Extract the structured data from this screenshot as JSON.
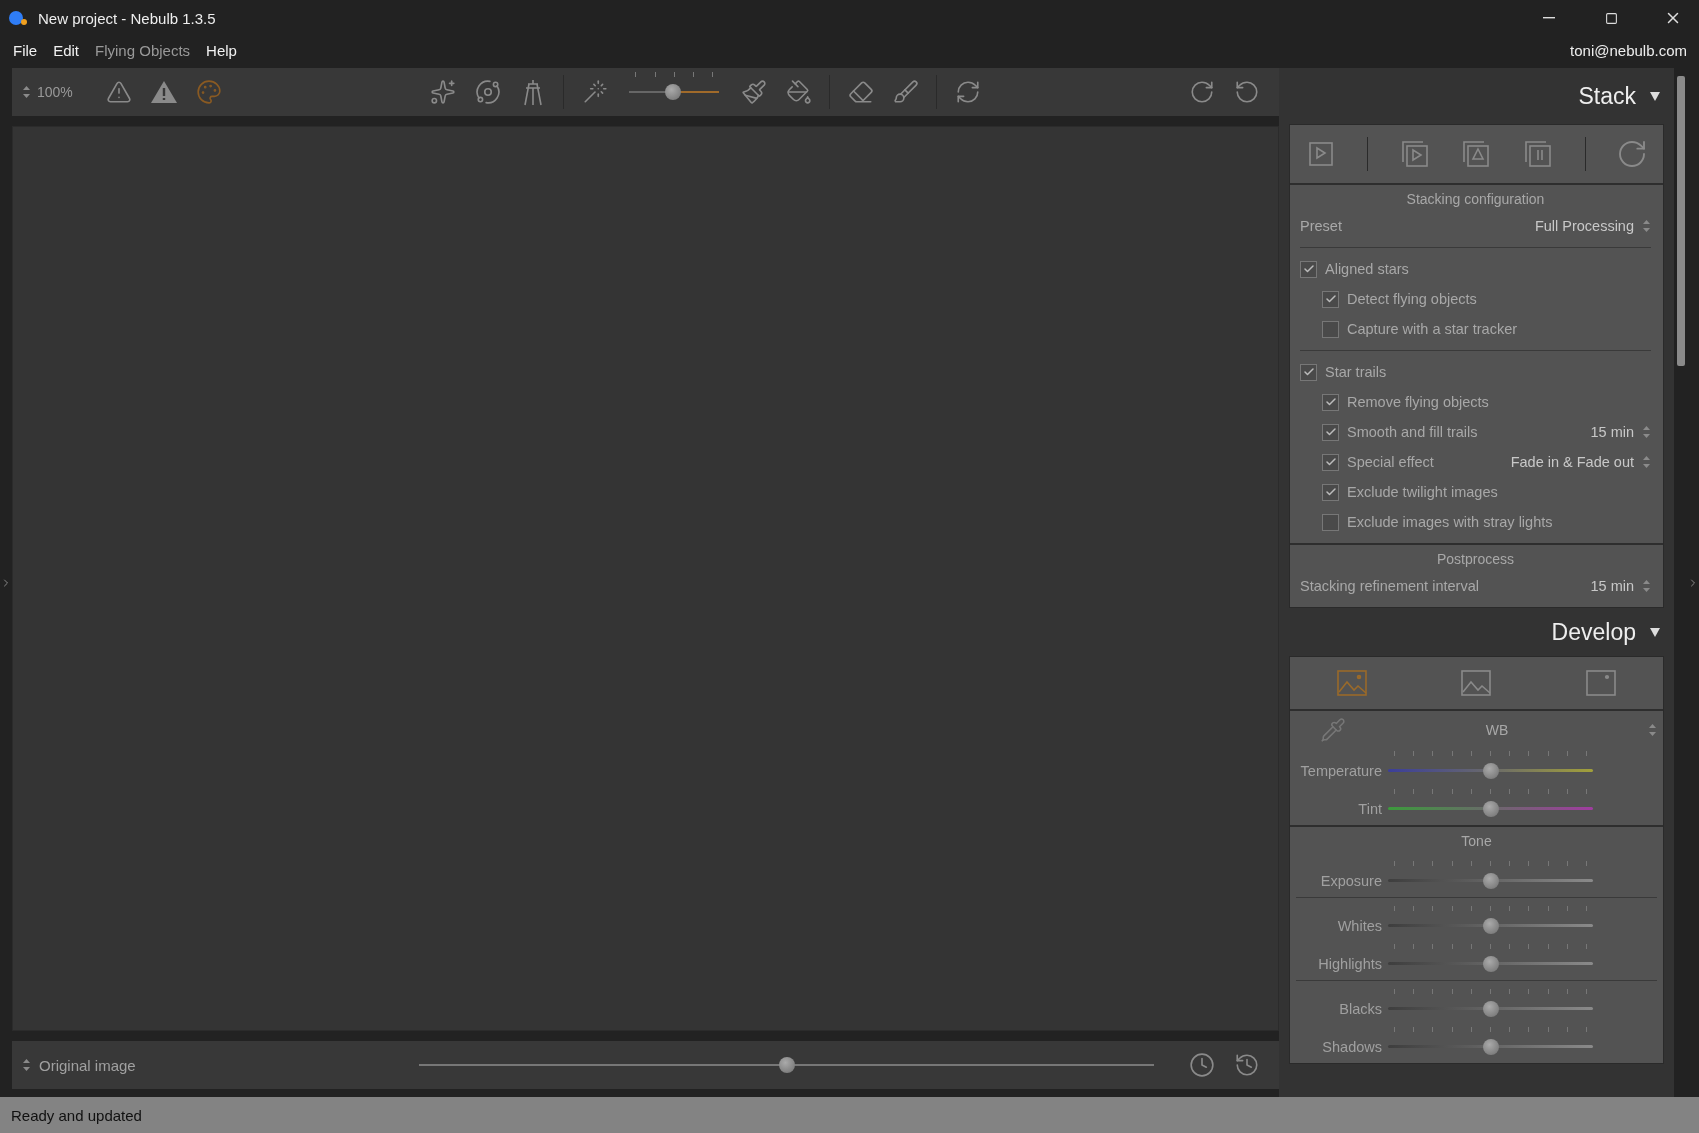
{
  "window": {
    "title": "New project - Nebulb 1.3.5"
  },
  "menu": [
    {
      "label": "File",
      "disabled": false
    },
    {
      "label": "Edit",
      "disabled": false
    },
    {
      "label": "Flying Objects",
      "disabled": true
    },
    {
      "label": "Help",
      "disabled": false
    }
  ],
  "account": "toni@nebulb.com",
  "toolbar": {
    "zoom": "100%",
    "brush_size": {
      "level": 0.48
    }
  },
  "viewer": {
    "compare_mode": "Original image",
    "position": {
      "level": 0.5
    }
  },
  "stack": {
    "title": "Stack",
    "config_title": "Stacking configuration",
    "preset": {
      "label": "Preset",
      "value": "Full Processing"
    },
    "groups": [
      {
        "label": "Aligned stars",
        "checked": true,
        "children": [
          {
            "label": "Detect flying objects",
            "checked": true
          },
          {
            "label": "Capture with a star tracker",
            "checked": false
          }
        ]
      },
      {
        "label": "Star trails",
        "checked": true,
        "children": [
          {
            "label": "Remove flying objects",
            "checked": true
          },
          {
            "label": "Smooth and fill trails",
            "checked": true,
            "value": "15 min"
          },
          {
            "label": "Special effect",
            "checked": true,
            "value": "Fade in & Fade out"
          },
          {
            "label": "Exclude twilight images",
            "checked": true
          },
          {
            "label": "Exclude images with stray lights",
            "checked": false
          }
        ]
      }
    ],
    "postprocess": {
      "title": "Postprocess",
      "label": "Stacking refinement interval",
      "value": "15 min"
    }
  },
  "develop": {
    "title": "Develop",
    "tabs": [
      {
        "selected": true
      },
      {
        "selected": false
      },
      {
        "selected": false
      }
    ],
    "wb": {
      "title": "WB",
      "sliders": [
        {
          "kind": "temperature",
          "label": "Temperature",
          "level": 0.5
        },
        {
          "kind": "tint",
          "label": "Tint",
          "level": 0.5
        }
      ]
    },
    "tone": {
      "title": "Tone",
      "groups": [
        {
          "sliders": [
            {
              "kind": "plain",
              "label": "Exposure",
              "level": 0.5
            }
          ]
        },
        {
          "sliders": [
            {
              "kind": "plain",
              "label": "Whites",
              "level": 0.5
            },
            {
              "kind": "plain",
              "label": "Highlights",
              "level": 0.5
            }
          ]
        },
        {
          "sliders": [
            {
              "kind": "plain",
              "label": "Blacks",
              "level": 0.5
            },
            {
              "kind": "plain",
              "label": "Shadows",
              "level": 0.5
            }
          ]
        }
      ]
    }
  },
  "status_bar": "Ready and updated"
}
